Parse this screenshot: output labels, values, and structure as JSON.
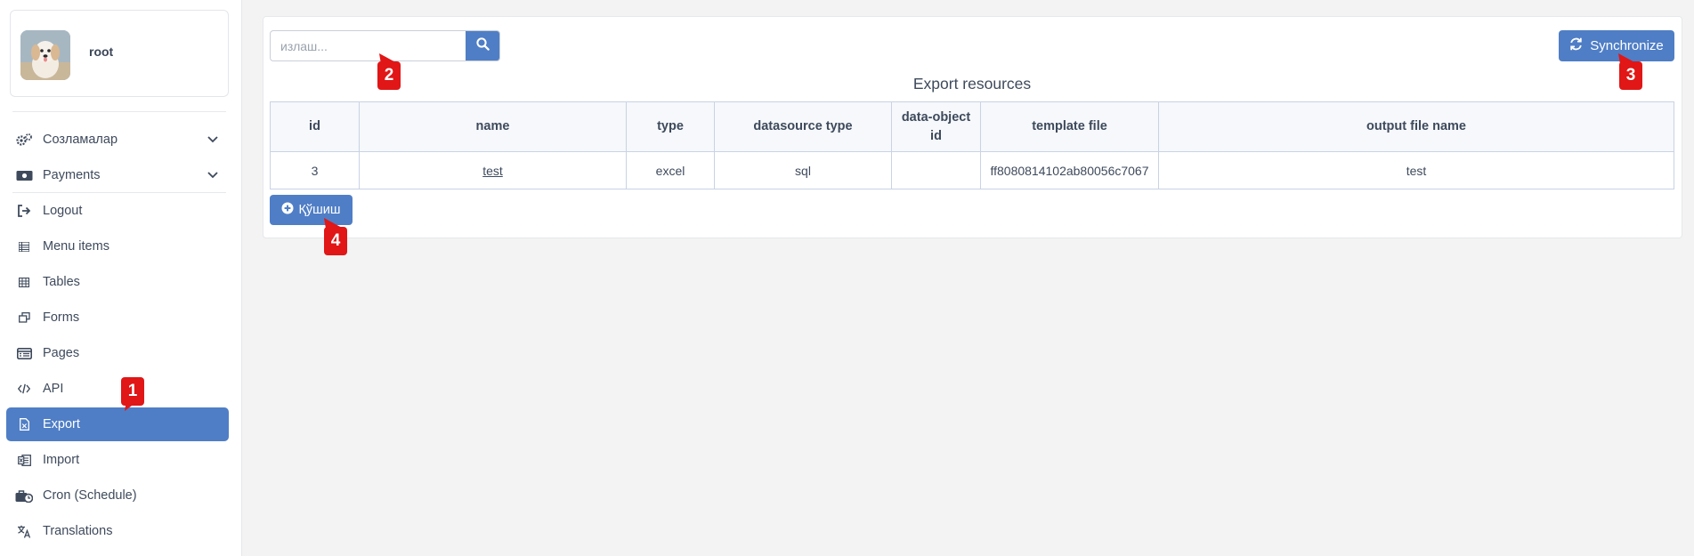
{
  "user": {
    "name": "root",
    "avatar_icon": "puppy-avatar"
  },
  "sidebar": {
    "items": [
      {
        "label": "Созламалар",
        "icon": "gears-icon",
        "has_chevron": true
      },
      {
        "label": "Payments",
        "icon": "money-icon",
        "has_chevron": true
      },
      {
        "label": "Logout",
        "icon": "logout-icon"
      },
      {
        "label": "Menu items",
        "icon": "list-icon"
      },
      {
        "label": "Tables",
        "icon": "table-icon"
      },
      {
        "label": "Forms",
        "icon": "windows-icon"
      },
      {
        "label": "Pages",
        "icon": "page-list-icon"
      },
      {
        "label": "API",
        "icon": "code-icon"
      },
      {
        "label": "Export",
        "icon": "file-export-icon",
        "active": true
      },
      {
        "label": "Import",
        "icon": "file-import-icon"
      },
      {
        "label": "Cron (Schedule)",
        "icon": "toolbox-clock-icon"
      },
      {
        "label": "Translations",
        "icon": "language-icon"
      }
    ]
  },
  "search": {
    "placeholder": "излаш...",
    "value": ""
  },
  "toolbar": {
    "sync_label": "Synchronize",
    "add_label": "Қўшиш"
  },
  "table": {
    "title": "Export resources",
    "headers": [
      "id",
      "name",
      "type",
      "datasource type",
      "data-object id",
      "template file",
      "output file name"
    ],
    "rows": [
      [
        "3",
        "test",
        "excel",
        "sql",
        "",
        "ff8080814102ab80056c7067",
        "test"
      ]
    ]
  },
  "annotations": [
    "1",
    "2",
    "3",
    "4"
  ],
  "colors": {
    "accent": "#4f7ec6",
    "badge": "#e11616",
    "background": "#f3f3f3"
  }
}
